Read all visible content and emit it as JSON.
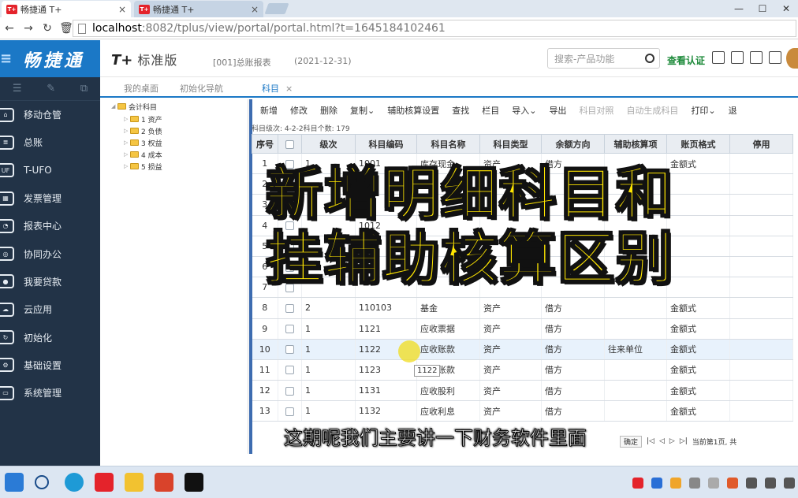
{
  "browser": {
    "tabs": [
      {
        "title": "畅捷通 T+",
        "active": true
      },
      {
        "title": "畅捷通 T+",
        "active": false
      }
    ],
    "tab_logo": "T+",
    "url_host": "localhost",
    "url_rest": ":8082/tplus/view/portal/portal.html?t=1645184102461"
  },
  "sidebar": {
    "brand": "畅捷通",
    "items": [
      {
        "label": "移动仓管",
        "icon": "house-icon"
      },
      {
        "label": "总账",
        "icon": "ledger-icon"
      },
      {
        "label": "T-UFO",
        "icon": "ufo-icon"
      },
      {
        "label": "发票管理",
        "icon": "grid-icon"
      },
      {
        "label": "报表中心",
        "icon": "pie-chart-icon"
      },
      {
        "label": "协同办公",
        "icon": "target-icon"
      },
      {
        "label": "我要贷款",
        "icon": "money-icon"
      },
      {
        "label": "云应用",
        "icon": "cloud-icon"
      },
      {
        "label": "初始化",
        "icon": "refresh-icon"
      },
      {
        "label": "基础设置",
        "icon": "gear-icon"
      },
      {
        "label": "系统管理",
        "icon": "monitor-icon"
      }
    ]
  },
  "header": {
    "tplus": "T+",
    "edition": "标准版",
    "account": "[001]总账报表",
    "date": "(2021-12-31)",
    "search_placeholder": "搜索-产品功能",
    "verify": "查看认证"
  },
  "module_tabs": [
    {
      "label": "我的桌面",
      "active": false
    },
    {
      "label": "初始化导航",
      "active": false
    },
    {
      "label": "科目",
      "active": true,
      "close": "×"
    }
  ],
  "tree": {
    "root": "会计科目",
    "children": [
      "1 资产",
      "2 负债",
      "3 权益",
      "4 成本",
      "5 损益"
    ]
  },
  "toolbar": [
    {
      "label": "新增",
      "enabled": true
    },
    {
      "label": "修改",
      "enabled": true
    },
    {
      "label": "删除",
      "enabled": true
    },
    {
      "label": "复制⌄",
      "enabled": true
    },
    {
      "label": "辅助核算设置",
      "enabled": true
    },
    {
      "label": "查找",
      "enabled": true
    },
    {
      "label": "栏目",
      "enabled": true
    },
    {
      "label": "导入⌄",
      "enabled": true
    },
    {
      "label": "导出",
      "enabled": true
    },
    {
      "label": "科目对照",
      "enabled": false
    },
    {
      "label": "自动生成科目",
      "enabled": false
    },
    {
      "label": "打印⌄",
      "enabled": true
    },
    {
      "label": "退",
      "enabled": true
    }
  ],
  "count_text": "科目级次:   4-2-2科目个数:    179",
  "grid": {
    "columns": [
      "序号",
      "",
      "级次",
      "科目编码",
      "科目名称",
      "科目类型",
      "余额方向",
      "辅助核算项",
      "账页格式",
      "停用"
    ],
    "rows": [
      [
        "1",
        "",
        "1",
        "1001",
        "库存现金",
        "资产",
        "借方",
        "",
        "金额式",
        ""
      ],
      [
        "2",
        "",
        "",
        "",
        "",
        "",
        "",
        "",
        "",
        ""
      ],
      [
        "3",
        "",
        "",
        "",
        "",
        "",
        "",
        "",
        "",
        ""
      ],
      [
        "4",
        "",
        "",
        "1012",
        "",
        "",
        "",
        "",
        "",
        ""
      ],
      [
        "5",
        "",
        "",
        "",
        "",
        "",
        "",
        "",
        "",
        ""
      ],
      [
        "6",
        "",
        "",
        "",
        "",
        "",
        "",
        "",
        "",
        ""
      ],
      [
        "7",
        "",
        "",
        "",
        "",
        "",
        "",
        "",
        "",
        ""
      ],
      [
        "8",
        "",
        "2",
        "110103",
        "基金",
        "资产",
        "借方",
        "",
        "金额式",
        ""
      ],
      [
        "9",
        "",
        "1",
        "1121",
        "应收票据",
        "资产",
        "借方",
        "",
        "金额式",
        ""
      ],
      [
        "10",
        "",
        "1",
        "1122",
        "应收账款",
        "资产",
        "借方",
        "往来单位",
        "金额式",
        ""
      ],
      [
        "11",
        "",
        "1",
        "1123",
        "预付账款",
        "资产",
        "借方",
        "",
        "金额式",
        ""
      ],
      [
        "12",
        "",
        "1",
        "1131",
        "应收股利",
        "资产",
        "借方",
        "",
        "金额式",
        ""
      ],
      [
        "13",
        "",
        "1",
        "1132",
        "应收利息",
        "资产",
        "借方",
        "",
        "金额式",
        ""
      ]
    ],
    "selected_row": 9
  },
  "tooltip": "1122",
  "overlay_title": [
    "新增明细科目和",
    "挂辅助核算区别"
  ],
  "subtitle": "这期呢我们主要讲一下财务软件里面",
  "pager": {
    "ok": "确定",
    "status": "当前第1页, 共"
  },
  "taskbar_icons": [
    "windows-start-icon",
    "search-icon",
    "edge-browser-icon",
    "tplus-app-icon",
    "file-explorer-icon",
    "office-icon",
    "capcut-icon"
  ],
  "colors": {
    "brand_blue": "#1b78c6",
    "sidebar_bg": "#223347",
    "overlay_yellow": "#ffe600",
    "verify_green": "#1d8a3a"
  }
}
